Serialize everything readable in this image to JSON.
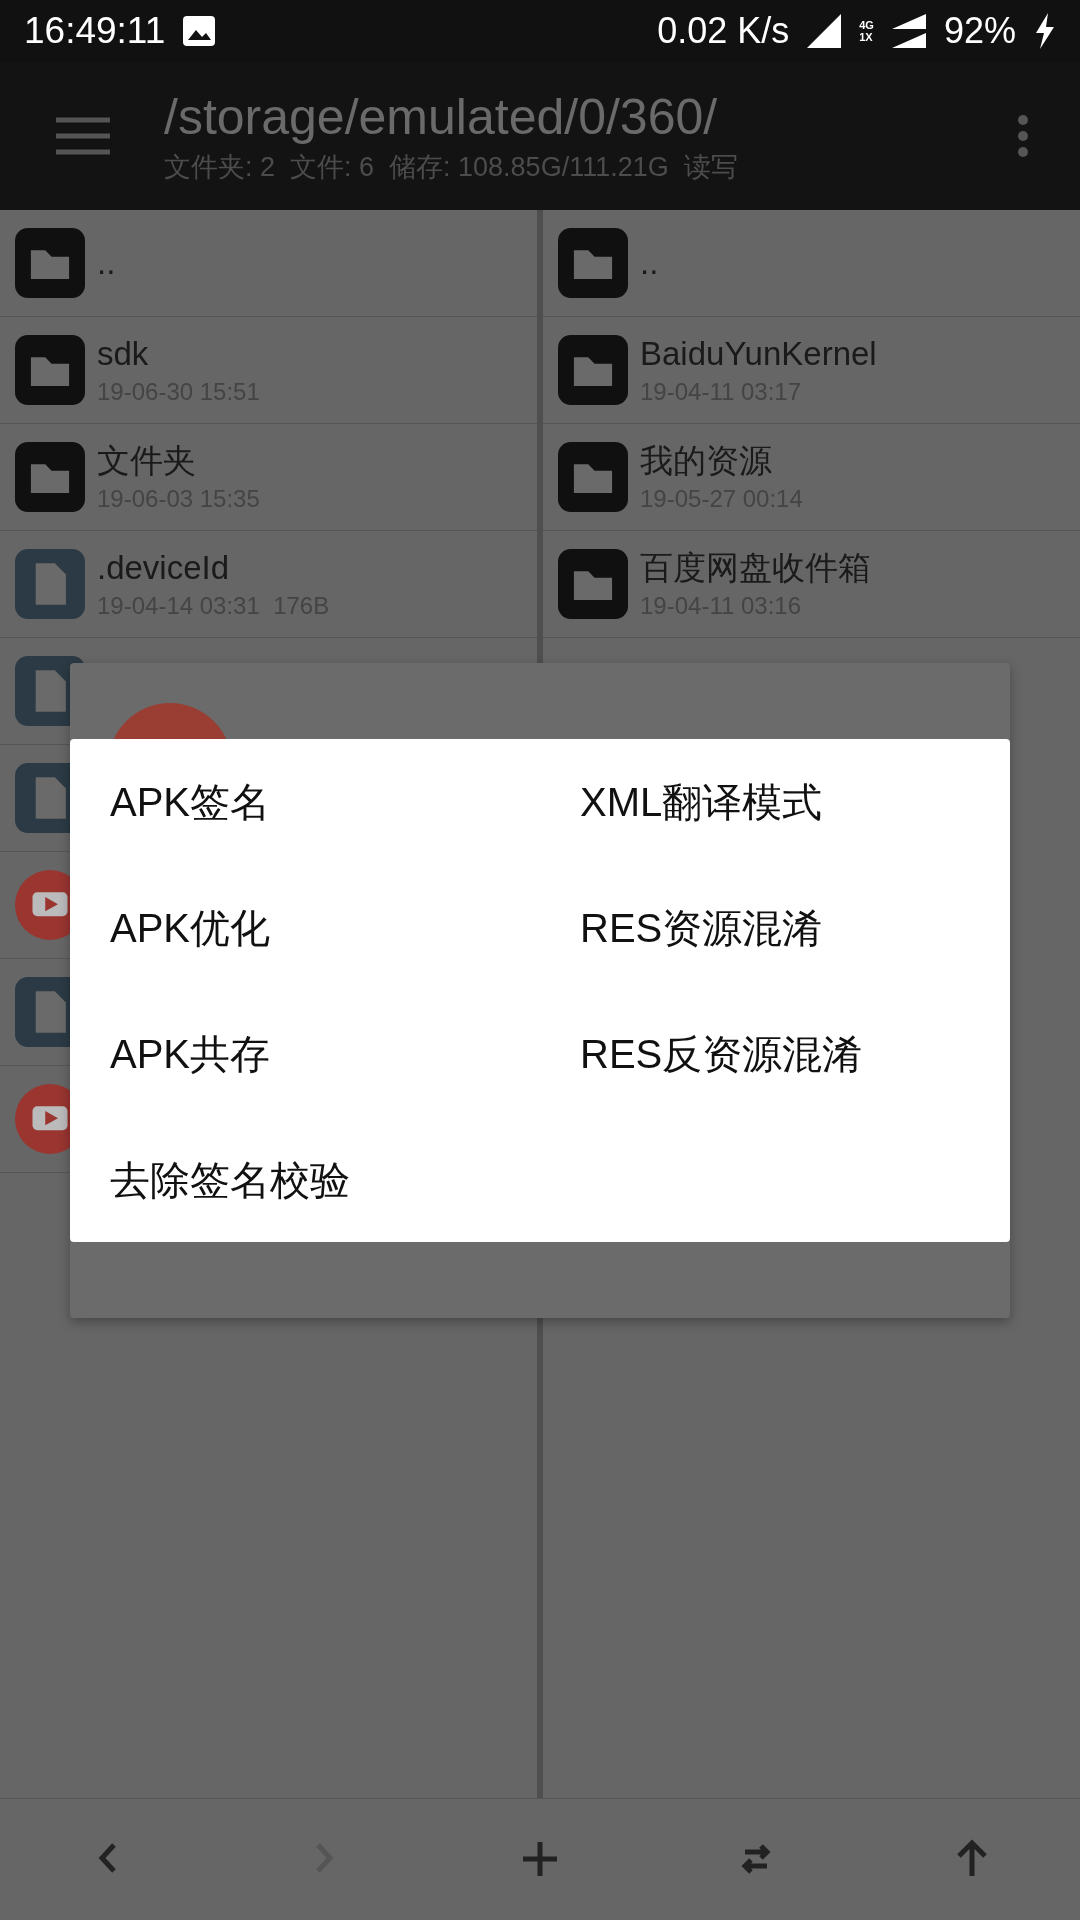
{
  "status_bar": {
    "time": "16:49:11",
    "speed": "0.02 K/s",
    "network": "4G",
    "sim": "1X",
    "battery": "92%"
  },
  "toolbar": {
    "path": "/storage/emulated/0/360/",
    "info": "文件夹: 2  文件: 6  储存: 108.85G/111.21G  读写"
  },
  "panes": [
    {
      "rows": [
        {
          "kind": "folder",
          "name": ".."
        },
        {
          "kind": "folder",
          "name": "sdk",
          "meta": "19-06-30 15:51"
        },
        {
          "kind": "folder",
          "name": "文件夹",
          "meta": "19-06-03 15:35"
        },
        {
          "kind": "file",
          "name": ".deviceId",
          "meta": "19-04-14 03:31  176B"
        },
        {
          "kind": "file"
        },
        {
          "kind": "file"
        },
        {
          "kind": "video"
        },
        {
          "kind": "file"
        },
        {
          "kind": "video"
        }
      ]
    },
    {
      "rows": [
        {
          "kind": "folder",
          "name": ".."
        },
        {
          "kind": "folder",
          "name": "BaiduYunKernel",
          "meta": "19-04-11 03:17"
        },
        {
          "kind": "folder",
          "name": "我的资源",
          "meta": "19-05-27 00:14"
        },
        {
          "kind": "folder",
          "name": "百度网盘收件箱",
          "meta": "19-04-11 03:16"
        }
      ]
    }
  ],
  "menu": [
    "APK签名",
    "XML翻译模式",
    "APK优化",
    "RES资源混淆",
    "APK共存",
    "RES反资源混淆",
    "去除签名校验"
  ],
  "bottom_bar": [
    {
      "kind": "back",
      "disabled": false
    },
    {
      "kind": "forward",
      "disabled": true
    },
    {
      "kind": "add",
      "disabled": false
    },
    {
      "kind": "swap",
      "disabled": false
    },
    {
      "kind": "up",
      "disabled": false
    }
  ]
}
